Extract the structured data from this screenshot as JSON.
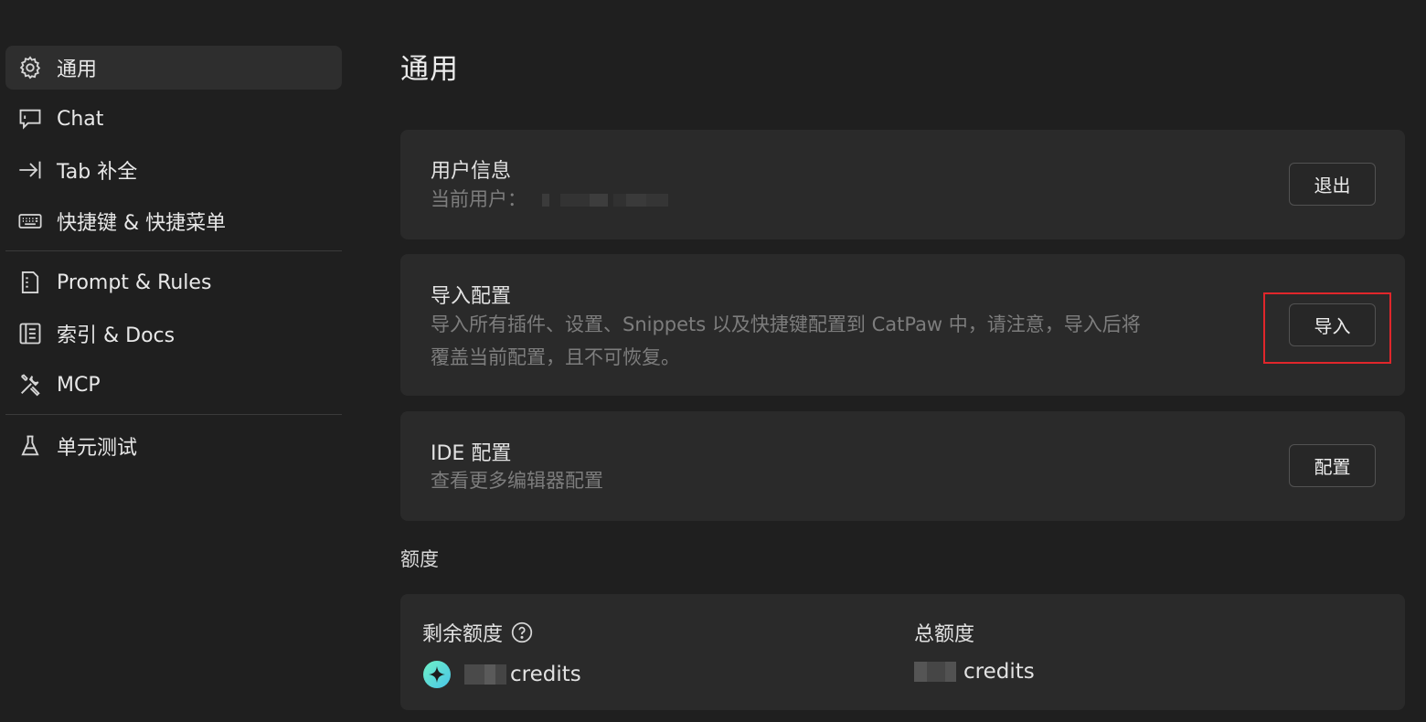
{
  "sidebar": {
    "items": [
      {
        "label": "通用",
        "icon": "gear-icon",
        "active": true
      },
      {
        "label": "Chat",
        "icon": "chat-icon"
      },
      {
        "label": "Tab 补全",
        "icon": "tab-arrow-icon"
      },
      {
        "label": "快捷键 & 快捷菜单",
        "icon": "keyboard-icon"
      },
      {
        "label": "Prompt & Rules",
        "icon": "document-icon"
      },
      {
        "label": "索引 & Docs",
        "icon": "book-icon"
      },
      {
        "label": "MCP",
        "icon": "tools-icon"
      },
      {
        "label": "单元测试",
        "icon": "flask-icon"
      }
    ]
  },
  "page": {
    "title": "通用"
  },
  "user_card": {
    "title": "用户信息",
    "current_user_label": "当前用户：",
    "logout_label": "退出"
  },
  "import_card": {
    "title": "导入配置",
    "desc_line1": "导入所有插件、设置、Snippets 以及快捷键配置到 CatPaw 中，请注意，导入后将",
    "desc_line2": "覆盖当前配置，且不可恢复。",
    "import_label": "导入"
  },
  "ide_card": {
    "title": "IDE 配置",
    "desc": "查看更多编辑器配置",
    "config_label": "配置"
  },
  "quota": {
    "section_label": "额度",
    "remaining_label": "剩余额度",
    "remaining_unit": "credits",
    "total_label": "总额度",
    "total_unit": "credits",
    "help_icon": "question-circle-icon",
    "credit_icon": "sparkle-coin-icon"
  },
  "colors": {
    "background": "#1f1f1f",
    "card": "#2a2a2a",
    "highlight": "#e0262b"
  }
}
